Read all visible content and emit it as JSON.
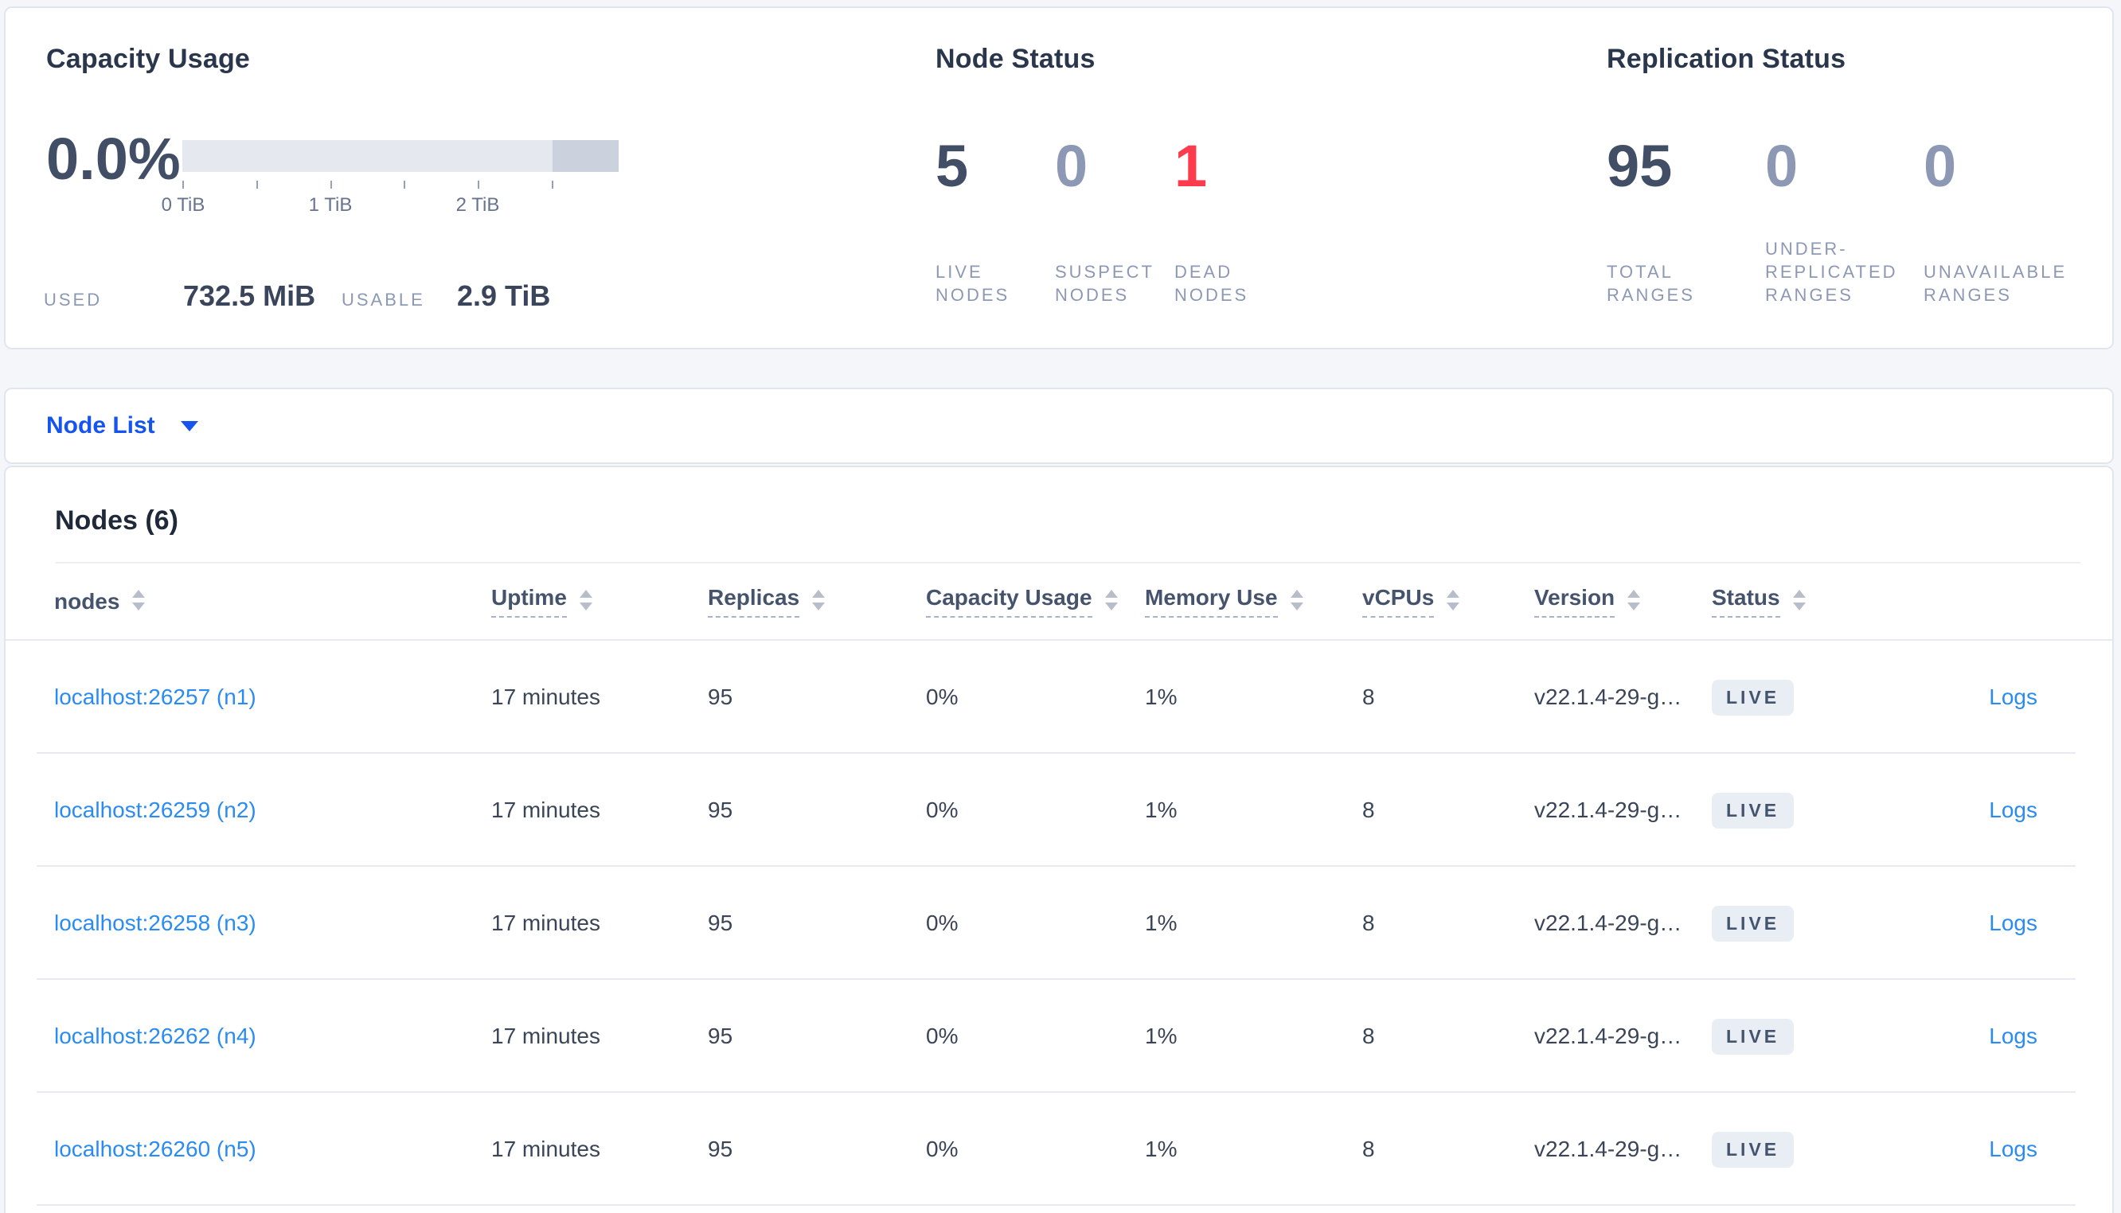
{
  "colors": {
    "page_background": "#f4f6fa",
    "panel_background": "#ffffff",
    "accent_link_blue": "#2a8cf2",
    "selector_blue": "#1554ef",
    "danger_red": "#fc3b4c",
    "muted_blue_gray": "#8d99b4",
    "dark_slate": "#414e66",
    "badge_background": "#e9edf4"
  },
  "capacity": {
    "title": "Capacity Usage",
    "percent": "0.0%",
    "tick_labels": [
      "0 TiB",
      "1 TiB",
      "2 TiB"
    ],
    "used_label": "USED",
    "used_value": "732.5 MiB",
    "usable_label": "USABLE",
    "usable_value": "2.9 TiB"
  },
  "node_status": {
    "title": "Node Status",
    "stats": [
      {
        "value": "5",
        "label": "LIVE NODES",
        "tone": "dark"
      },
      {
        "value": "0",
        "label": "SUSPECT NODES",
        "tone": "muted"
      },
      {
        "value": "1",
        "label": "DEAD NODES",
        "tone": "danger"
      }
    ]
  },
  "replication": {
    "title": "Replication Status",
    "stats": [
      {
        "value": "95",
        "label": "TOTAL RANGES",
        "tone": "dark"
      },
      {
        "value": "0",
        "label": "UNDER-REPLICATED RANGES",
        "tone": "muted"
      },
      {
        "value": "0",
        "label": "UNAVAILABLE RANGES",
        "tone": "muted"
      }
    ]
  },
  "view_selector": {
    "label": "Node List"
  },
  "table": {
    "title": "Nodes (6)",
    "columns": [
      {
        "label": "nodes",
        "dashed": false,
        "sortable": true
      },
      {
        "label": "Uptime",
        "dashed": true,
        "sortable": true
      },
      {
        "label": "Replicas",
        "dashed": true,
        "sortable": true
      },
      {
        "label": "Capacity Usage",
        "dashed": true,
        "sortable": true
      },
      {
        "label": "Memory Use",
        "dashed": true,
        "sortable": true
      },
      {
        "label": "vCPUs",
        "dashed": true,
        "sortable": true
      },
      {
        "label": "Version",
        "dashed": true,
        "sortable": true
      },
      {
        "label": "Status",
        "dashed": true,
        "sortable": true
      },
      {
        "label": "",
        "dashed": false,
        "sortable": false
      }
    ],
    "rows": [
      {
        "node": "localhost:26257 (n1)",
        "uptime": "17 minutes",
        "replicas": "95",
        "capacity": "0%",
        "memory": "1%",
        "vcpus": "8",
        "version": "v22.1.4-29-g…",
        "status": "LIVE",
        "logs": "Logs"
      },
      {
        "node": "localhost:26259 (n2)",
        "uptime": "17 minutes",
        "replicas": "95",
        "capacity": "0%",
        "memory": "1%",
        "vcpus": "8",
        "version": "v22.1.4-29-g…",
        "status": "LIVE",
        "logs": "Logs"
      },
      {
        "node": "localhost:26258 (n3)",
        "uptime": "17 minutes",
        "replicas": "95",
        "capacity": "0%",
        "memory": "1%",
        "vcpus": "8",
        "version": "v22.1.4-29-g…",
        "status": "LIVE",
        "logs": "Logs"
      },
      {
        "node": "localhost:26262 (n4)",
        "uptime": "17 minutes",
        "replicas": "95",
        "capacity": "0%",
        "memory": "1%",
        "vcpus": "8",
        "version": "v22.1.4-29-g…",
        "status": "LIVE",
        "logs": "Logs"
      },
      {
        "node": "localhost:26260 (n5)",
        "uptime": "17 minutes",
        "replicas": "95",
        "capacity": "0%",
        "memory": "1%",
        "vcpus": "8",
        "version": "v22.1.4-29-g…",
        "status": "LIVE",
        "logs": "Logs"
      }
    ]
  }
}
